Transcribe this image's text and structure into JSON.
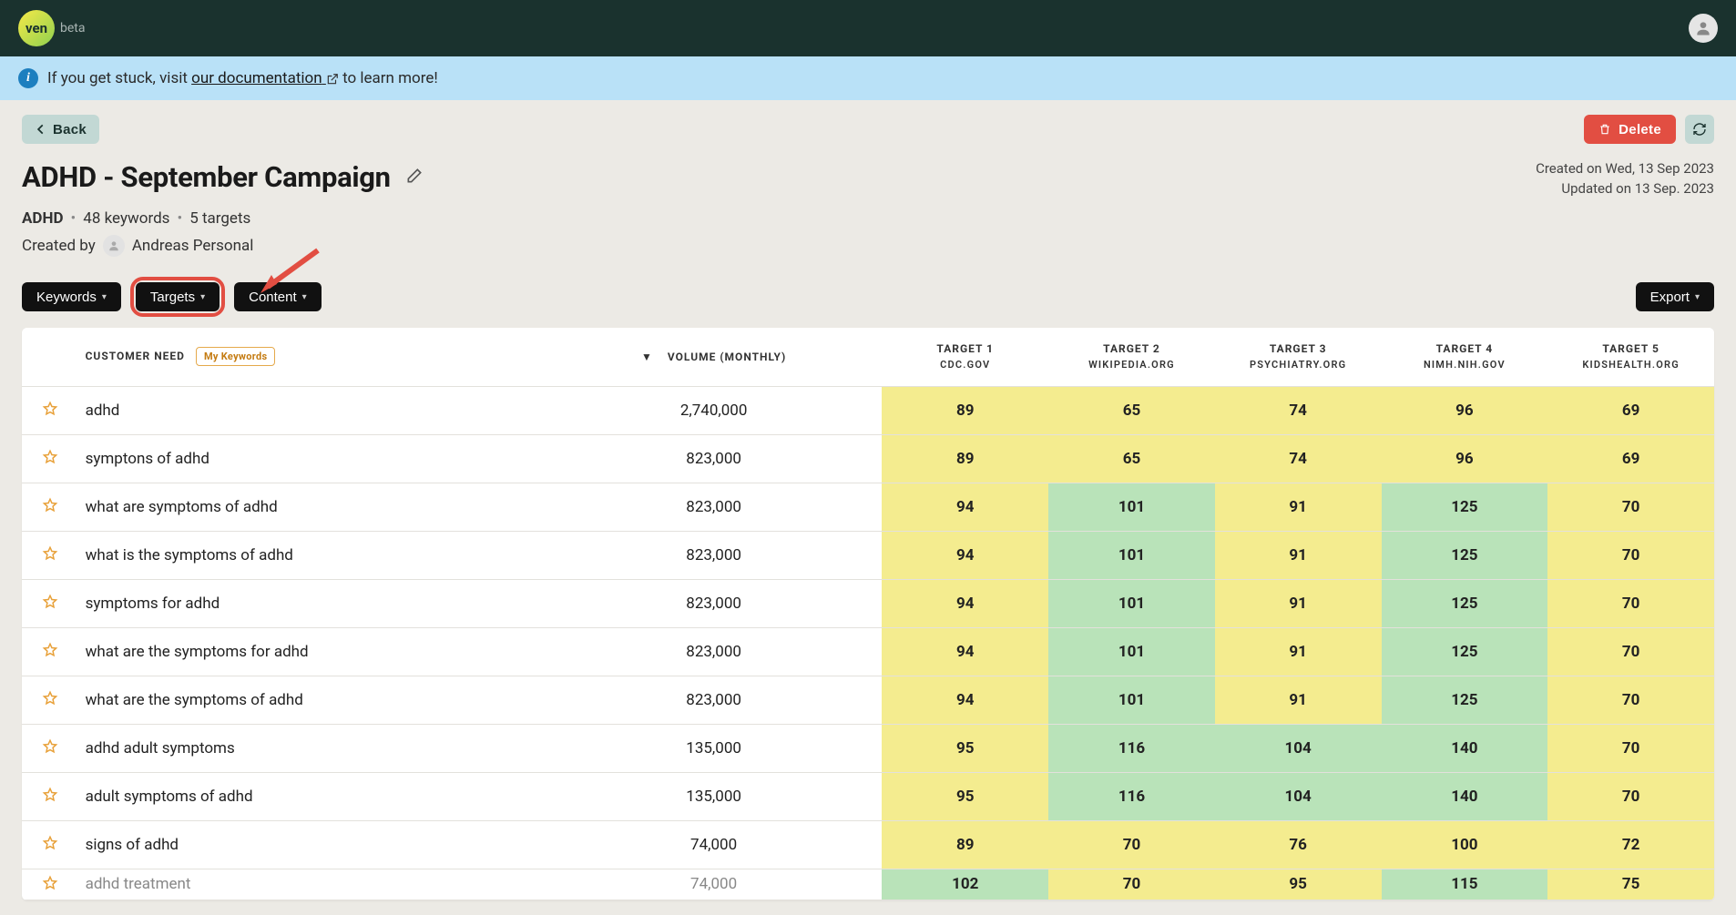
{
  "nav": {
    "logo_text": "ven",
    "beta_label": "beta"
  },
  "banner": {
    "prefix": "If you get stuck, visit ",
    "link_text": "our documentation",
    "suffix": " to learn more!"
  },
  "actions": {
    "back_label": "Back",
    "delete_label": "Delete",
    "export_label": "Export"
  },
  "title": "ADHD - September Campaign",
  "meta": {
    "created": "Created on Wed, 13 Sep 2023",
    "updated": "Updated on 13 Sep. 2023"
  },
  "subtitle": {
    "tag": "ADHD",
    "kw_count": "48 keywords",
    "tgt_count": "5 targets"
  },
  "created_by": {
    "label": "Created by",
    "name": "Andreas Personal"
  },
  "pills": {
    "keywords": "Keywords",
    "targets": "Targets",
    "content": "Content"
  },
  "table": {
    "head": {
      "customer_need": "CUSTOMER NEED",
      "my_keywords_badge": "My Keywords",
      "volume": "VOLUME (MONTHLY)",
      "targets": [
        {
          "label": "TARGET 1",
          "domain": "CDC.GOV"
        },
        {
          "label": "TARGET 2",
          "domain": "WIKIPEDIA.ORG"
        },
        {
          "label": "TARGET 3",
          "domain": "PSYCHIATRY.ORG"
        },
        {
          "label": "TARGET 4",
          "domain": "NIMH.NIH.GOV"
        },
        {
          "label": "TARGET 5",
          "domain": "KIDSHEALTH.ORG"
        }
      ]
    },
    "rows": [
      {
        "kw": "adhd",
        "vol": "2,740,000",
        "s": [
          {
            "v": "89",
            "c": "y"
          },
          {
            "v": "65",
            "c": "y"
          },
          {
            "v": "74",
            "c": "y"
          },
          {
            "v": "96",
            "c": "y"
          },
          {
            "v": "69",
            "c": "y"
          }
        ]
      },
      {
        "kw": "symptons of adhd",
        "vol": "823,000",
        "s": [
          {
            "v": "89",
            "c": "y"
          },
          {
            "v": "65",
            "c": "y"
          },
          {
            "v": "74",
            "c": "y"
          },
          {
            "v": "96",
            "c": "y"
          },
          {
            "v": "69",
            "c": "y"
          }
        ]
      },
      {
        "kw": "what are symptoms of adhd",
        "vol": "823,000",
        "s": [
          {
            "v": "94",
            "c": "y"
          },
          {
            "v": "101",
            "c": "g"
          },
          {
            "v": "91",
            "c": "y"
          },
          {
            "v": "125",
            "c": "g"
          },
          {
            "v": "70",
            "c": "y"
          }
        ]
      },
      {
        "kw": "what is the symptoms of adhd",
        "vol": "823,000",
        "s": [
          {
            "v": "94",
            "c": "y"
          },
          {
            "v": "101",
            "c": "g"
          },
          {
            "v": "91",
            "c": "y"
          },
          {
            "v": "125",
            "c": "g"
          },
          {
            "v": "70",
            "c": "y"
          }
        ]
      },
      {
        "kw": "symptoms for adhd",
        "vol": "823,000",
        "s": [
          {
            "v": "94",
            "c": "y"
          },
          {
            "v": "101",
            "c": "g"
          },
          {
            "v": "91",
            "c": "y"
          },
          {
            "v": "125",
            "c": "g"
          },
          {
            "v": "70",
            "c": "y"
          }
        ]
      },
      {
        "kw": "what are the symptoms for adhd",
        "vol": "823,000",
        "s": [
          {
            "v": "94",
            "c": "y"
          },
          {
            "v": "101",
            "c": "g"
          },
          {
            "v": "91",
            "c": "y"
          },
          {
            "v": "125",
            "c": "g"
          },
          {
            "v": "70",
            "c": "y"
          }
        ]
      },
      {
        "kw": "what are the symptoms of adhd",
        "vol": "823,000",
        "s": [
          {
            "v": "94",
            "c": "y"
          },
          {
            "v": "101",
            "c": "g"
          },
          {
            "v": "91",
            "c": "y"
          },
          {
            "v": "125",
            "c": "g"
          },
          {
            "v": "70",
            "c": "y"
          }
        ]
      },
      {
        "kw": "adhd adult symptoms",
        "vol": "135,000",
        "s": [
          {
            "v": "95",
            "c": "y"
          },
          {
            "v": "116",
            "c": "g"
          },
          {
            "v": "104",
            "c": "g"
          },
          {
            "v": "140",
            "c": "g"
          },
          {
            "v": "70",
            "c": "y"
          }
        ]
      },
      {
        "kw": "adult symptoms of adhd",
        "vol": "135,000",
        "s": [
          {
            "v": "95",
            "c": "y"
          },
          {
            "v": "116",
            "c": "g"
          },
          {
            "v": "104",
            "c": "g"
          },
          {
            "v": "140",
            "c": "g"
          },
          {
            "v": "70",
            "c": "y"
          }
        ]
      },
      {
        "kw": "signs of adhd",
        "vol": "74,000",
        "s": [
          {
            "v": "89",
            "c": "y"
          },
          {
            "v": "70",
            "c": "y"
          },
          {
            "v": "76",
            "c": "y"
          },
          {
            "v": "100",
            "c": "y"
          },
          {
            "v": "72",
            "c": "y"
          }
        ]
      }
    ],
    "partial_row": {
      "kw": "adhd treatment",
      "vol": "74,000",
      "s": [
        {
          "v": "102",
          "c": "g"
        },
        {
          "v": "70",
          "c": "y"
        },
        {
          "v": "95",
          "c": "y"
        },
        {
          "v": "115",
          "c": "g"
        },
        {
          "v": "75",
          "c": "y"
        }
      ]
    }
  }
}
